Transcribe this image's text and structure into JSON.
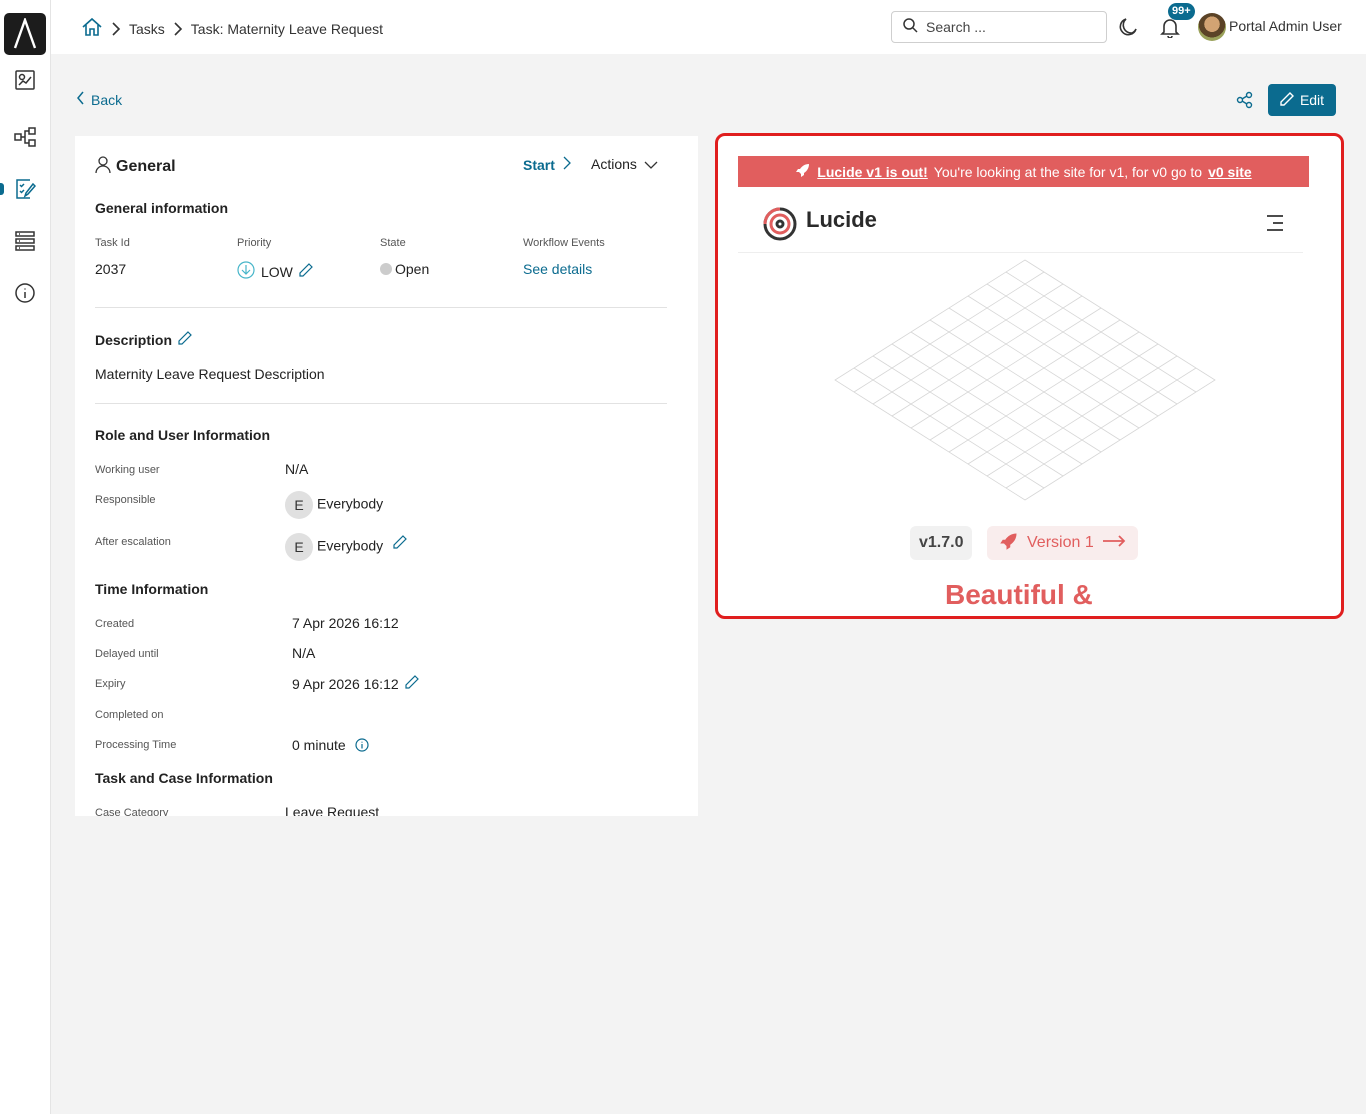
{
  "breadcrumb": {
    "items": [
      "Tasks",
      "Task: Maternity Leave Request"
    ]
  },
  "header": {
    "search_placeholder": "Search ...",
    "notification_count": "99+",
    "user_name": "Portal Admin User"
  },
  "actions": {
    "back_label": "Back",
    "edit_label": "Edit"
  },
  "general": {
    "title": "General",
    "start_label": "Start",
    "actions_label": "Actions",
    "section_title": "General information",
    "task_id_label": "Task Id",
    "task_id": "2037",
    "priority_label": "Priority",
    "priority": "LOW",
    "state_label": "State",
    "state": "Open",
    "workflow_label": "Workflow Events",
    "workflow_link": "See details"
  },
  "description": {
    "title": "Description",
    "text": "Maternity Leave Request Description"
  },
  "role": {
    "title": "Role and User Information",
    "working_user_label": "Working user",
    "working_user": "N/A",
    "responsible_label": "Responsible",
    "responsible_initial": "E",
    "responsible": "Everybody",
    "escalation_label": "After escalation",
    "escalation_initial": "E",
    "escalation": "Everybody"
  },
  "time": {
    "title": "Time Information",
    "created_label": "Created",
    "created": "7 Apr 2026 16:12",
    "delayed_label": "Delayed until",
    "delayed": "N/A",
    "expiry_label": "Expiry",
    "expiry": "9 Apr 2026 16:12",
    "completed_label": "Completed on",
    "processing_label": "Processing Time",
    "processing": "0 minute"
  },
  "case": {
    "title": "Task and Case Information",
    "category_label": "Case Category",
    "category": "Leave Request"
  },
  "preview": {
    "banner_link": "Lucide v1 is out!",
    "banner_text": "You're looking at the site for v1, for v0 go to",
    "banner_link2": "v0 site",
    "brand": "Lucide",
    "version": "v1.7.0",
    "version_link": "Version 1",
    "headline": "Beautiful &"
  },
  "colors": {
    "primary": "#0b6b8f",
    "lucide_red": "#e15e5e",
    "highlight_border": "#e01e1e"
  }
}
